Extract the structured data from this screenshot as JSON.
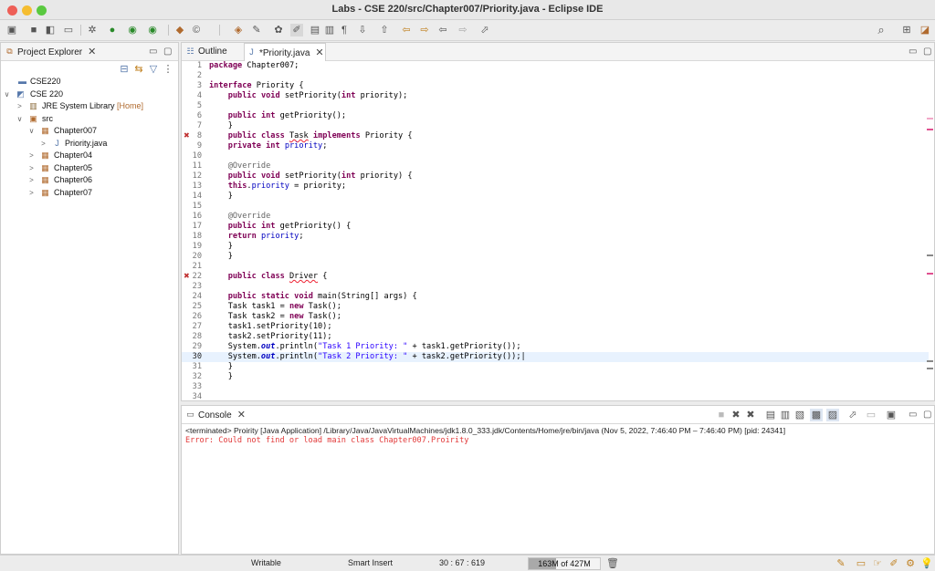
{
  "window": {
    "title": "Labs - CSE 220/src/Chapter007/Priority.java - Eclipse IDE"
  },
  "project_explorer": {
    "tab_label": "Project Explorer",
    "tree": [
      {
        "label": "CSE220",
        "deco": ""
      },
      {
        "label": "CSE 220",
        "deco": ""
      },
      {
        "label": "JRE System Library",
        "deco": "[Home]"
      },
      {
        "label": "src",
        "deco": ""
      },
      {
        "label": "Chapter007",
        "deco": ""
      },
      {
        "label": "Priority.java",
        "deco": ""
      },
      {
        "label": "Chapter04",
        "deco": ""
      },
      {
        "label": "Chapter05",
        "deco": ""
      },
      {
        "label": "Chapter06",
        "deco": ""
      },
      {
        "label": "Chapter07",
        "deco": ""
      }
    ]
  },
  "editor": {
    "tabs": [
      {
        "label": "Outline"
      },
      {
        "label": "*Priority.java"
      }
    ],
    "line_numbers": [
      "1",
      "2",
      "3",
      "4",
      "5",
      "6",
      "7",
      "8",
      "9",
      "10",
      "11",
      "12",
      "13",
      "14",
      "15",
      "16",
      "17",
      "18",
      "19",
      "20",
      "21",
      "22",
      "23",
      "24",
      "25",
      "26",
      "27",
      "28",
      "29",
      "30",
      "31",
      "32",
      "33",
      "34"
    ],
    "current_line": 30
  },
  "console": {
    "tab_label": "Console",
    "terminated": "<terminated> Proirity [Java Application] /Library/Java/JavaVirtualMachines/jdk1.8.0_333.jdk/Contents/Home/jre/bin/java  (Nov 5, 2022, 7:46:40 PM – 7:46:40 PM) [pid: 24341]",
    "error": "Error: Could not find or load main class Chapter007.Proirity"
  },
  "status": {
    "writable": "Writable",
    "insert_mode": "Smart Insert",
    "position": "30 : 67 : 619",
    "heap": "163M of 427M",
    "heap_fraction": 0.38
  },
  "colors": {
    "keyword": "#7f0055",
    "string": "#2a00ff",
    "field": "#0000c0",
    "error": "#e23a3a"
  }
}
